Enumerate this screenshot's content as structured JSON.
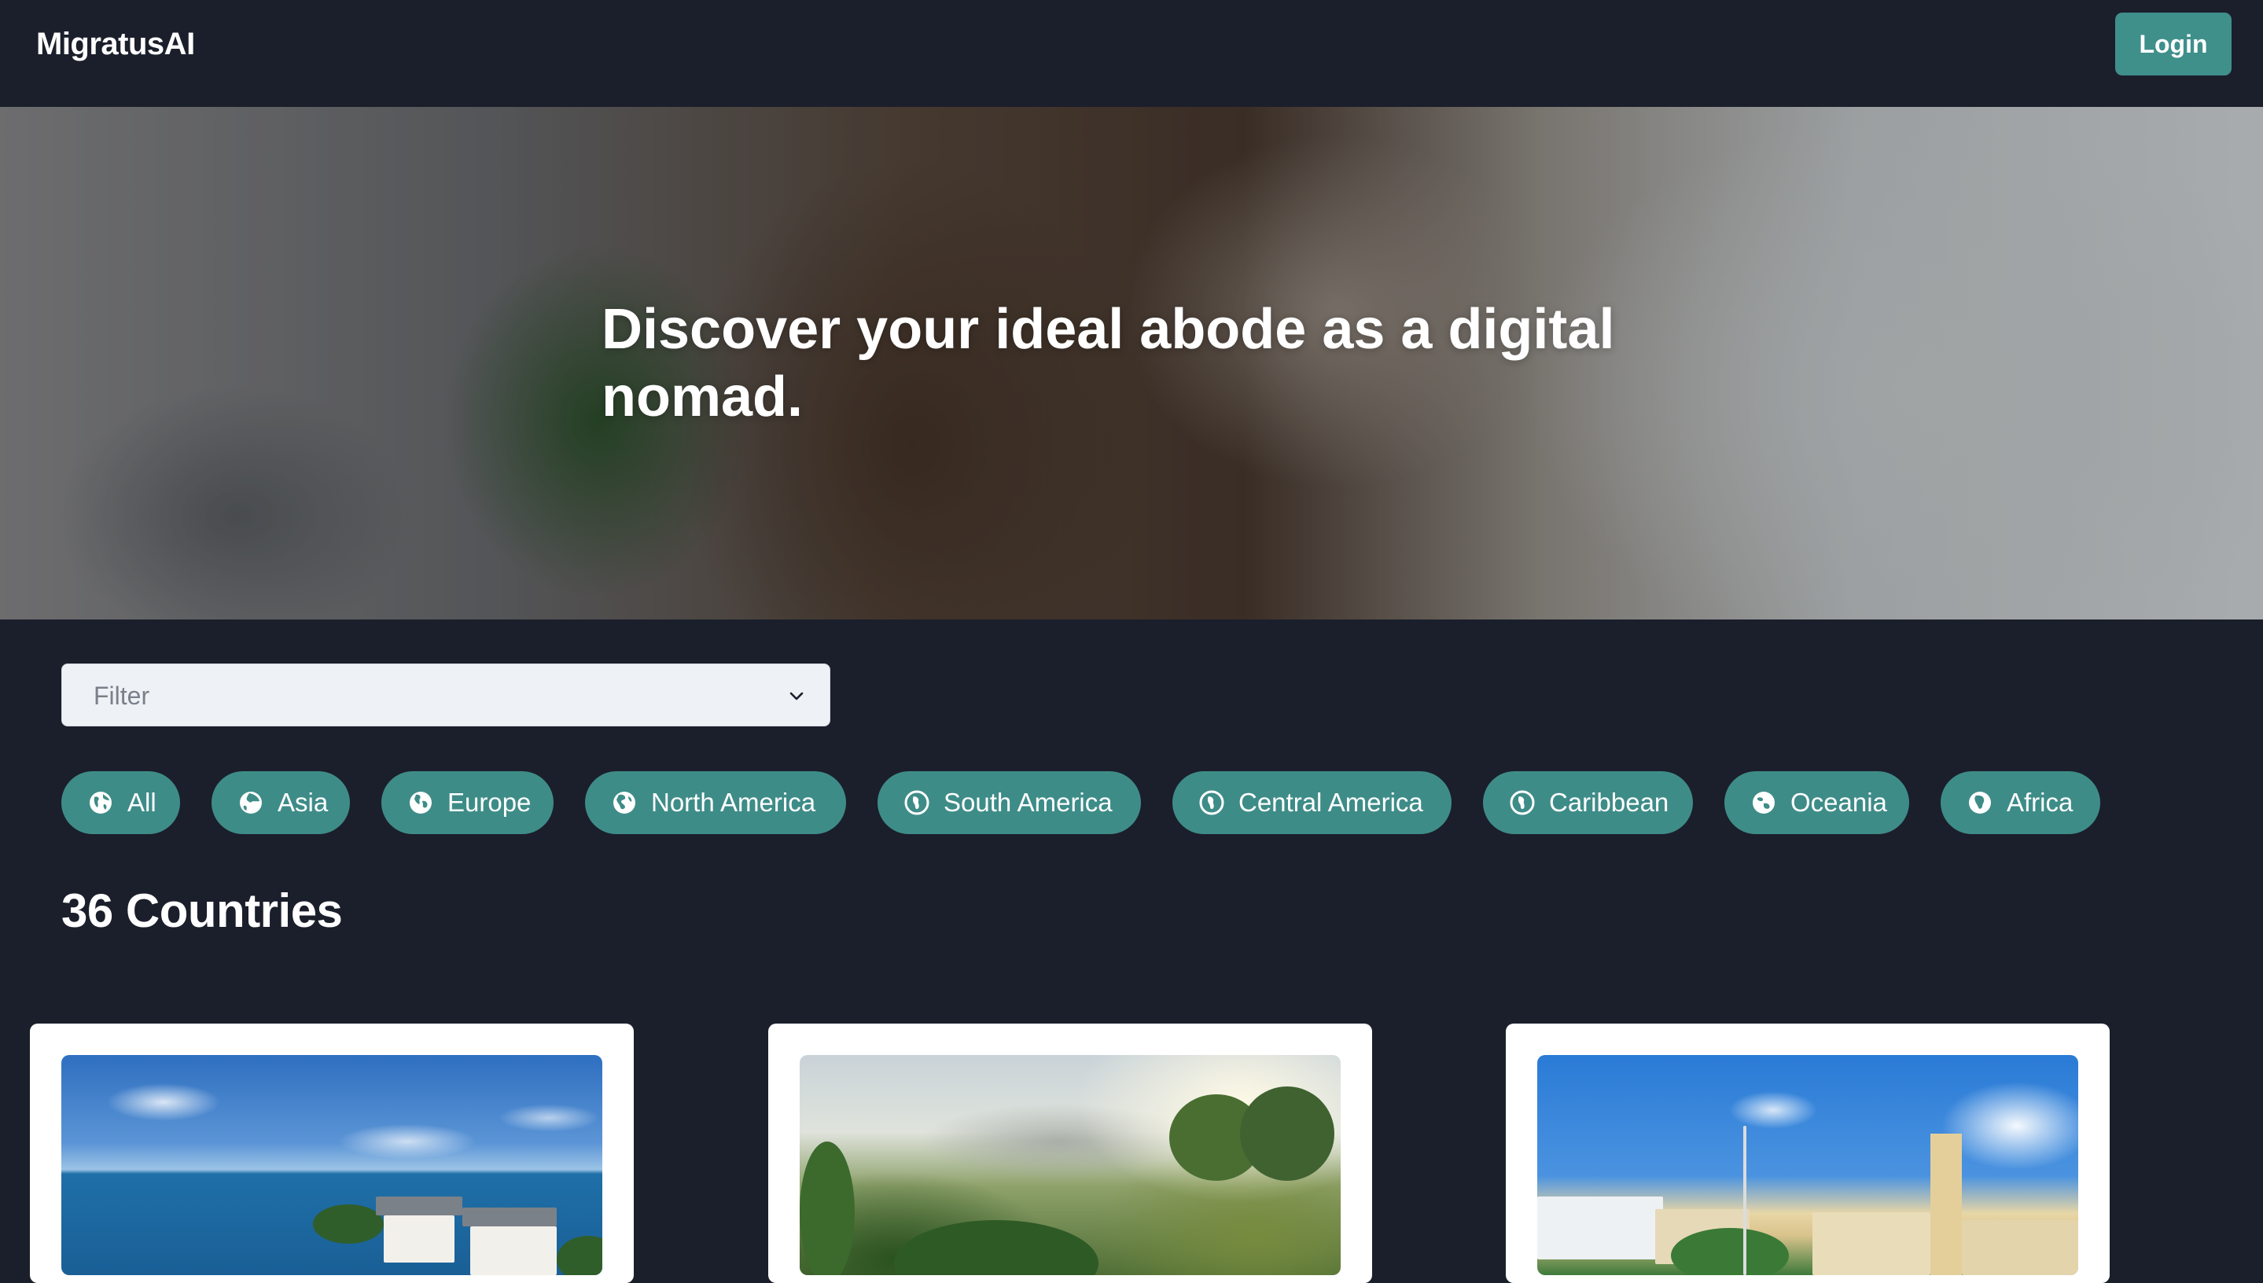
{
  "app": {
    "brand": "MigratusAI",
    "login_label": "Login"
  },
  "hero": {
    "title": "Discover your ideal abode as a digital nomad."
  },
  "filter": {
    "placeholder": "Filter"
  },
  "regions": [
    {
      "label": "All",
      "icon": "globe-icon"
    },
    {
      "label": "Asia",
      "icon": "globe-asia-icon"
    },
    {
      "label": "Europe",
      "icon": "globe-europe-icon"
    },
    {
      "label": "North America",
      "icon": "globe-americas-icon"
    },
    {
      "label": "South America",
      "icon": "globe-americas-icon"
    },
    {
      "label": "Central America",
      "icon": "globe-americas-icon"
    },
    {
      "label": "Caribbean",
      "icon": "globe-americas-icon"
    },
    {
      "label": "Oceania",
      "icon": "globe-oceania-icon"
    },
    {
      "label": "Africa",
      "icon": "globe-africa-icon"
    }
  ],
  "results": {
    "count_label": "36 Countries"
  },
  "colors": {
    "background": "#1b1f2b",
    "accent": "#3e8c88",
    "filter_bg": "#eef1f5",
    "card_bg": "#ffffff"
  },
  "cards": [
    {
      "image": "beach-resort-photo"
    },
    {
      "image": "jungle-volcano-photo"
    },
    {
      "image": "harbor-clocktower-photo"
    }
  ]
}
